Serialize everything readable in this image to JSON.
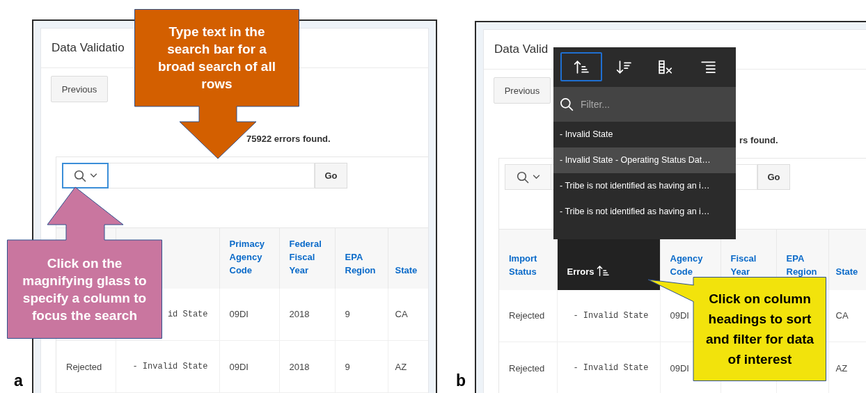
{
  "panels": [
    {
      "label": "a",
      "title": "Data Validatio",
      "previous_button": "Previous",
      "count": "75922 errors found.",
      "search": {
        "column_button_focused": true,
        "go_button": "Go"
      },
      "columns": [
        {
          "kind": "text"
        },
        {
          "kind": "code"
        },
        {
          "kind": "text",
          "label": "Primacy Agency Code",
          "active": false
        },
        {
          "kind": "text",
          "label": "Federal Fiscal Year",
          "active": false
        },
        {
          "kind": "text",
          "label": "EPA Region",
          "active": false
        },
        {
          "kind": "text",
          "label": "State",
          "active": false
        }
      ],
      "rows": [
        [
          null,
          "id State",
          "09DI",
          "2018",
          "9",
          "CA"
        ],
        [
          "Rejected",
          "- Invalid State",
          "09DI",
          "2018",
          "9",
          "AZ"
        ]
      ]
    },
    {
      "label": "b",
      "title": "Data Valid",
      "previous_button": "Previous",
      "count": "rs found.",
      "search": {
        "column_button_focused": false,
        "go_button": "Go"
      },
      "columns": [
        {
          "kind": "text",
          "label": "Import Status",
          "active": false
        },
        {
          "kind": "code",
          "label": "Errors",
          "active": true
        },
        {
          "kind": "text",
          "label": "Agency Code",
          "active": false
        },
        {
          "kind": "text",
          "label": "Fiscal Year",
          "active": false
        },
        {
          "kind": "text",
          "label": "EPA Region",
          "active": false
        },
        {
          "kind": "text",
          "label": "State",
          "active": false
        }
      ],
      "rows": [
        [
          "Rejected",
          "- Invalid State",
          "09DI",
          null,
          null,
          "CA"
        ],
        [
          "Rejected",
          "- Invalid State",
          "09DI",
          null,
          null,
          "AZ"
        ]
      ],
      "column_menu": {
        "tools": [
          {
            "kind": "sort-ascending",
            "selected": true
          },
          {
            "kind": "sort-descending",
            "selected": false
          },
          {
            "kind": "hide-column",
            "selected": false
          },
          {
            "kind": "control-break",
            "selected": false
          }
        ],
        "filter_placeholder": "Filter...",
        "options": [
          {
            "label": "- Invalid State",
            "selected": false
          },
          {
            "label": "- Invalid State - Operating Status Dat…",
            "selected": true
          },
          {
            "label": "- Tribe is not identified as having an i…",
            "selected": false
          },
          {
            "label": "- Tribe is not identified as having an i…",
            "selected": false
          }
        ]
      }
    }
  ],
  "callouts": [
    {
      "kind": "arrow-down",
      "color": "#d35f00",
      "text": "Type text in the search bar for a broad search of all rows"
    },
    {
      "kind": "arrow-up",
      "color": "#c9769f",
      "text": "Click on the magnifying glass to specify a column to focus the search"
    },
    {
      "kind": "speech",
      "color": "#f2e30c",
      "text": "Click on column headings to sort and filter for data of interest"
    }
  ]
}
